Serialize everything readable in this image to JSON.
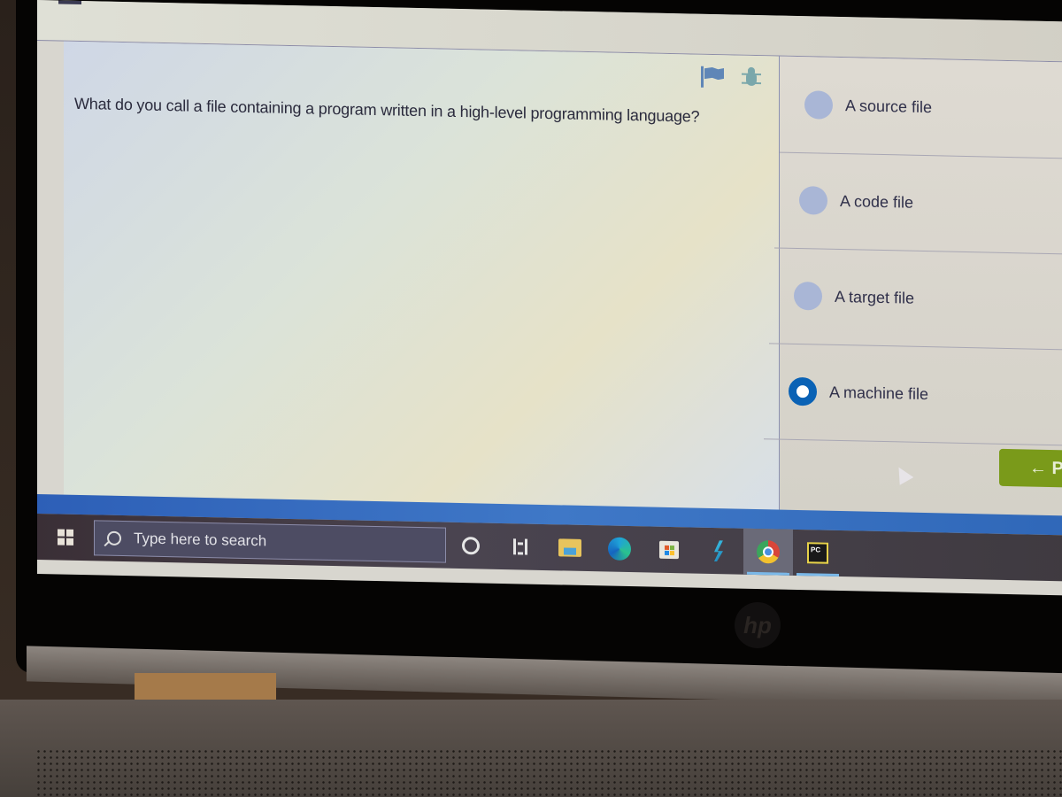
{
  "question": {
    "text": "What do you call a file containing a program written in a high-level programming language?",
    "icons": [
      "flag-icon",
      "bug-icon"
    ]
  },
  "answers": [
    {
      "label": "A source file",
      "selected": false
    },
    {
      "label": "A code file",
      "selected": false
    },
    {
      "label": "A target file",
      "selected": false
    },
    {
      "label": "A machine file",
      "selected": true
    }
  ],
  "navigation": {
    "prev_label": "← P",
    "accent_color": "#7a9a1a"
  },
  "taskbar": {
    "search_placeholder": "Type here to search",
    "apps": [
      "cortana-icon",
      "task-view-icon",
      "file-explorer-icon",
      "edge-icon",
      "store-icon",
      "app-icon",
      "chrome-icon",
      "pycharm-icon"
    ],
    "pycharm_text": "PC"
  },
  "device": {
    "logo": "hp"
  },
  "colors": {
    "selected_radio": "#0a62b5",
    "unselected_radio": "#a9b6d6"
  }
}
